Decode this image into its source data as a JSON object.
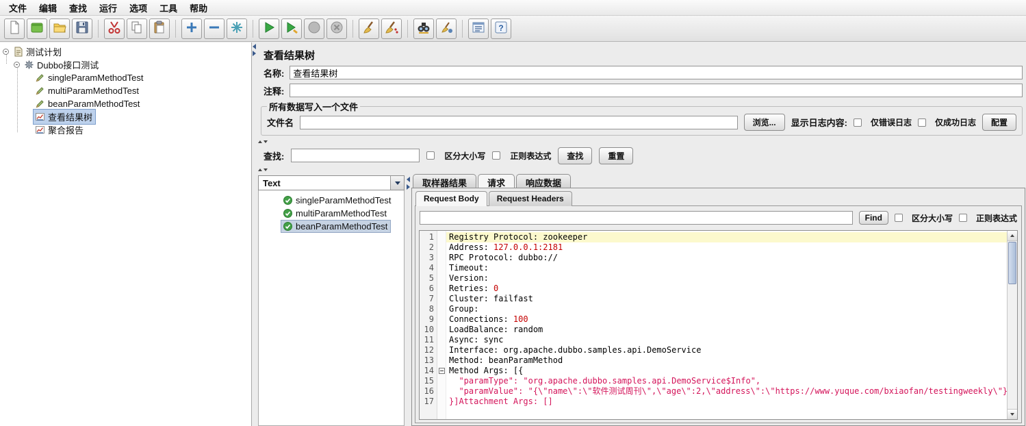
{
  "menu": {
    "items": [
      {
        "id": "file",
        "label": "文件"
      },
      {
        "id": "edit",
        "label": "编辑"
      },
      {
        "id": "search",
        "label": "查找"
      },
      {
        "id": "run",
        "label": "运行"
      },
      {
        "id": "options",
        "label": "选项"
      },
      {
        "id": "tools",
        "label": "工具"
      },
      {
        "id": "help",
        "label": "帮助"
      }
    ]
  },
  "toolbar": {
    "groups": [
      [
        {
          "id": "new-file",
          "icon": "new-file"
        },
        {
          "id": "templates",
          "icon": "templates"
        },
        {
          "id": "open-file",
          "icon": "open-file"
        },
        {
          "id": "save",
          "icon": "save"
        }
      ],
      [
        {
          "id": "cut",
          "icon": "cut"
        },
        {
          "id": "copy",
          "icon": "copy"
        },
        {
          "id": "paste",
          "icon": "paste"
        }
      ],
      [
        {
          "id": "expand-all",
          "icon": "expand-all"
        },
        {
          "id": "collapse-all",
          "icon": "collapse-all"
        },
        {
          "id": "toggle",
          "icon": "toggle"
        }
      ],
      [
        {
          "id": "start",
          "icon": "start"
        },
        {
          "id": "start-no-pauses",
          "icon": "start-no-pauses"
        },
        {
          "id": "stop",
          "icon": "stop",
          "disabled": true
        },
        {
          "id": "shutdown",
          "icon": "shutdown",
          "disabled": true
        }
      ],
      [
        {
          "id": "clear",
          "icon": "clear"
        },
        {
          "id": "clear-all",
          "icon": "clear-all"
        }
      ],
      [
        {
          "id": "search",
          "icon": "search"
        },
        {
          "id": "search-reset",
          "icon": "search-reset"
        }
      ],
      [
        {
          "id": "function-helper",
          "icon": "function-helper"
        },
        {
          "id": "help",
          "icon": "help"
        }
      ]
    ]
  },
  "tree": {
    "items": [
      {
        "id": "test-plan",
        "label": "测试计划",
        "level": 0,
        "icon": "test-plan",
        "toggle": true
      },
      {
        "id": "dubbo-test",
        "label": "Dubbo接口测试",
        "level": 1,
        "icon": "gear",
        "toggle": true
      },
      {
        "id": "single-param-method-test",
        "label": "singleParamMethodTest",
        "level": 2,
        "icon": "sampler"
      },
      {
        "id": "multi-param-method-test",
        "label": "multiParamMethodTest",
        "level": 2,
        "icon": "sampler"
      },
      {
        "id": "bean-param-method-test",
        "label": "beanParamMethodTest",
        "level": 2,
        "icon": "sampler"
      },
      {
        "id": "view-results-tree",
        "label": "查看结果树",
        "level": 2,
        "icon": "listener",
        "selected": true
      },
      {
        "id": "aggregate-report",
        "label": "聚合报告",
        "level": 2,
        "icon": "listener"
      }
    ]
  },
  "panel": {
    "title": "查看结果树",
    "name_label": "名称:",
    "name_value": "查看结果树",
    "comment_label": "注释:",
    "comment_value": "",
    "file_group": {
      "legend": "所有数据写入一个文件",
      "filename_label": "文件名",
      "filename_value": "",
      "browse_button": "浏览...",
      "log_display_label": "显示日志内容:",
      "errors_only": "仅错误日志",
      "success_only": "仅成功日志",
      "config_button": "配置"
    },
    "search": {
      "label": "查找:",
      "value": "",
      "case_sensitive": "区分大小写",
      "regex": "正则表达式",
      "find_button": "查找",
      "reset_button": "重置"
    }
  },
  "results": {
    "view_mode": "Text",
    "items": [
      {
        "id": "single-param-method-test",
        "label": "singleParamMethodTest"
      },
      {
        "id": "multi-param-method-test",
        "label": "multiParamMethodTest"
      },
      {
        "id": "bean-param-method-test",
        "label": "beanParamMethodTest",
        "selected": true
      }
    ],
    "tabs": [
      {
        "id": "sampler-result",
        "label": "取样器结果"
      },
      {
        "id": "request",
        "label": "请求",
        "selected": true
      },
      {
        "id": "response-data",
        "label": "响应数据"
      }
    ],
    "subtabs": [
      {
        "id": "request-body",
        "label": "Request Body",
        "selected": true
      },
      {
        "id": "request-headers",
        "label": "Request Headers"
      }
    ],
    "find": {
      "value": "",
      "find_button": "Find",
      "case_sensitive": "区分大小写",
      "regex": "正则表达式"
    }
  },
  "code": {
    "colors": {
      "p": "#000000",
      "n": "#c40000",
      "s": "#d4145a"
    },
    "lines": [
      {
        "num": 1,
        "highlight": true,
        "segments": [
          {
            "t": "Registry Protocol: zookeeper",
            "c": "p"
          }
        ]
      },
      {
        "num": 2,
        "segments": [
          {
            "t": "Address: ",
            "c": "p"
          },
          {
            "t": "127.0.0.1:2181",
            "c": "n"
          }
        ]
      },
      {
        "num": 3,
        "segments": [
          {
            "t": "RPC Protocol: dubbo://",
            "c": "p"
          }
        ]
      },
      {
        "num": 4,
        "segments": [
          {
            "t": "Timeout:",
            "c": "p"
          }
        ]
      },
      {
        "num": 5,
        "segments": [
          {
            "t": "Version:",
            "c": "p"
          }
        ]
      },
      {
        "num": 6,
        "segments": [
          {
            "t": "Retries: ",
            "c": "p"
          },
          {
            "t": "0",
            "c": "n"
          }
        ]
      },
      {
        "num": 7,
        "segments": [
          {
            "t": "Cluster: failfast",
            "c": "p"
          }
        ]
      },
      {
        "num": 8,
        "segments": [
          {
            "t": "Group:",
            "c": "p"
          }
        ]
      },
      {
        "num": 9,
        "segments": [
          {
            "t": "Connections: ",
            "c": "p"
          },
          {
            "t": "100",
            "c": "n"
          }
        ]
      },
      {
        "num": 10,
        "segments": [
          {
            "t": "LoadBalance: random",
            "c": "p"
          }
        ]
      },
      {
        "num": 11,
        "segments": [
          {
            "t": "Async: sync",
            "c": "p"
          }
        ]
      },
      {
        "num": 12,
        "segments": [
          {
            "t": "Interface: org.apache.dubbo.samples.api.DemoService",
            "c": "p"
          }
        ]
      },
      {
        "num": 13,
        "segments": [
          {
            "t": "Method: beanParamMethod",
            "c": "p"
          }
        ]
      },
      {
        "num": 14,
        "fold": true,
        "segments": [
          {
            "t": "Method Args: [{",
            "c": "p"
          }
        ]
      },
      {
        "num": 15,
        "segments": [
          {
            "t": "  ",
            "c": "p"
          },
          {
            "t": "\"paramType\": \"org.apache.dubbo.samples.api.DemoService$Info\",",
            "c": "s"
          }
        ]
      },
      {
        "num": 16,
        "segments": [
          {
            "t": "  ",
            "c": "p"
          },
          {
            "t": "\"paramValue\": \"{\\\"name\\\":\\\"软件测试周刊\\\",\\\"age\\\":2,\\\"address\\\":\\\"https://www.yuque.com/bxiaofan/testingweekly\\\"}\"",
            "c": "s"
          }
        ]
      },
      {
        "num": 17,
        "segments": [
          {
            "t": "}]Attachment Args: []",
            "c": "s"
          }
        ]
      }
    ]
  }
}
